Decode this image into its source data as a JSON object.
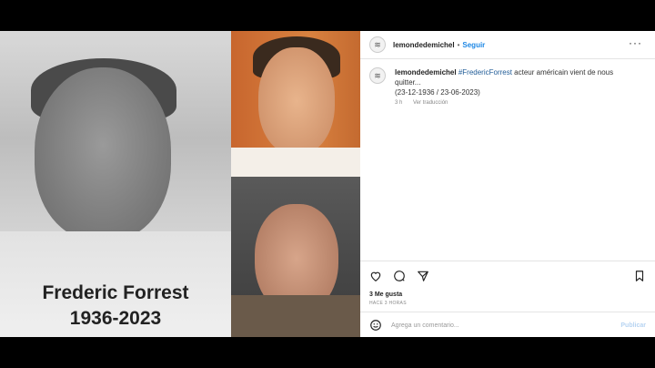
{
  "photo": {
    "name": "Frederic Forrest",
    "years": "1936-2023"
  },
  "post": {
    "username": "lemondedemichel",
    "follow_label": "Seguir",
    "caption_username": "lemondedemichel",
    "caption_hashtag": "#FredericForrest",
    "caption_text": " acteur américain vient de nous quitter...",
    "caption_dates": "(23-12-1936 / 23-06-2023)",
    "time": "3 h",
    "translate": "Ver traducción",
    "likes": "3 Me gusta",
    "time_ago": "HACE 3 HORAS",
    "comment_placeholder": "Agrega un comentario...",
    "publish_label": "Publicar"
  },
  "colors": {
    "link": "#1e88e5",
    "hashtag": "#1e5a96",
    "text": "#222222"
  },
  "icons": [
    "heart-icon",
    "comment-icon",
    "share-icon",
    "bookmark-icon",
    "emoji-icon",
    "more-icon"
  ]
}
